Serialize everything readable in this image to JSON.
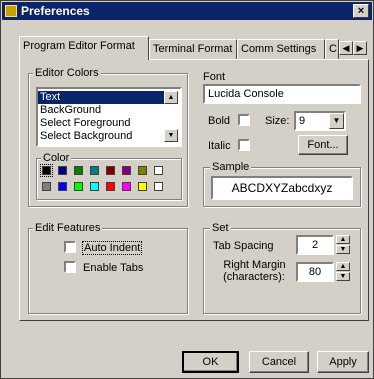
{
  "window": {
    "title": "Preferences",
    "close_glyph": "×"
  },
  "tabs": [
    {
      "label": "Program Editor Format",
      "active": true
    },
    {
      "label": "Terminal Format"
    },
    {
      "label": "Comm Settings"
    },
    {
      "label": "C"
    }
  ],
  "tab_scroll": {
    "left": "◀",
    "right": "▶"
  },
  "editor_colors": {
    "label": "Editor Colors",
    "items": [
      "Text",
      "BackGround",
      "Select Foreground",
      "Select Background"
    ],
    "selected_index": 0,
    "scroll_up": "▲",
    "scroll_down": "▼",
    "color_label": "Color",
    "swatches_row1": [
      "#000000",
      "#000080",
      "#008000",
      "#008080",
      "#800000",
      "#800080",
      "#808000",
      "#ffffff"
    ],
    "swatches_row2": [
      "#808080",
      "#0000ff",
      "#00ff00",
      "#00ffff",
      "#ff0000",
      "#ff00ff",
      "#ffff00",
      "#ffffff"
    ]
  },
  "font": {
    "label": "Font",
    "name": "Lucida Console",
    "bold_label": "Bold",
    "italic_label": "Italic",
    "size_label": "Size:",
    "size_value": "9",
    "size_arrow": "▼",
    "font_button": "Font..."
  },
  "sample": {
    "label": "Sample",
    "text": "ABCDXYZabcdxyz"
  },
  "edit_features": {
    "label": "Edit Features",
    "auto_indent_label": "Auto Indent",
    "enable_tabs_label": "Enable Tabs"
  },
  "set": {
    "label": "Set",
    "tab_spacing_label": "Tab Spacing",
    "tab_spacing_value": "2",
    "right_margin_label": "Right Margin",
    "right_margin_sub": "(characters):",
    "right_margin_value": "80",
    "spin_up": "▲",
    "spin_down": "▼"
  },
  "buttons": {
    "ok": "OK",
    "cancel": "Cancel",
    "apply": "Apply"
  }
}
